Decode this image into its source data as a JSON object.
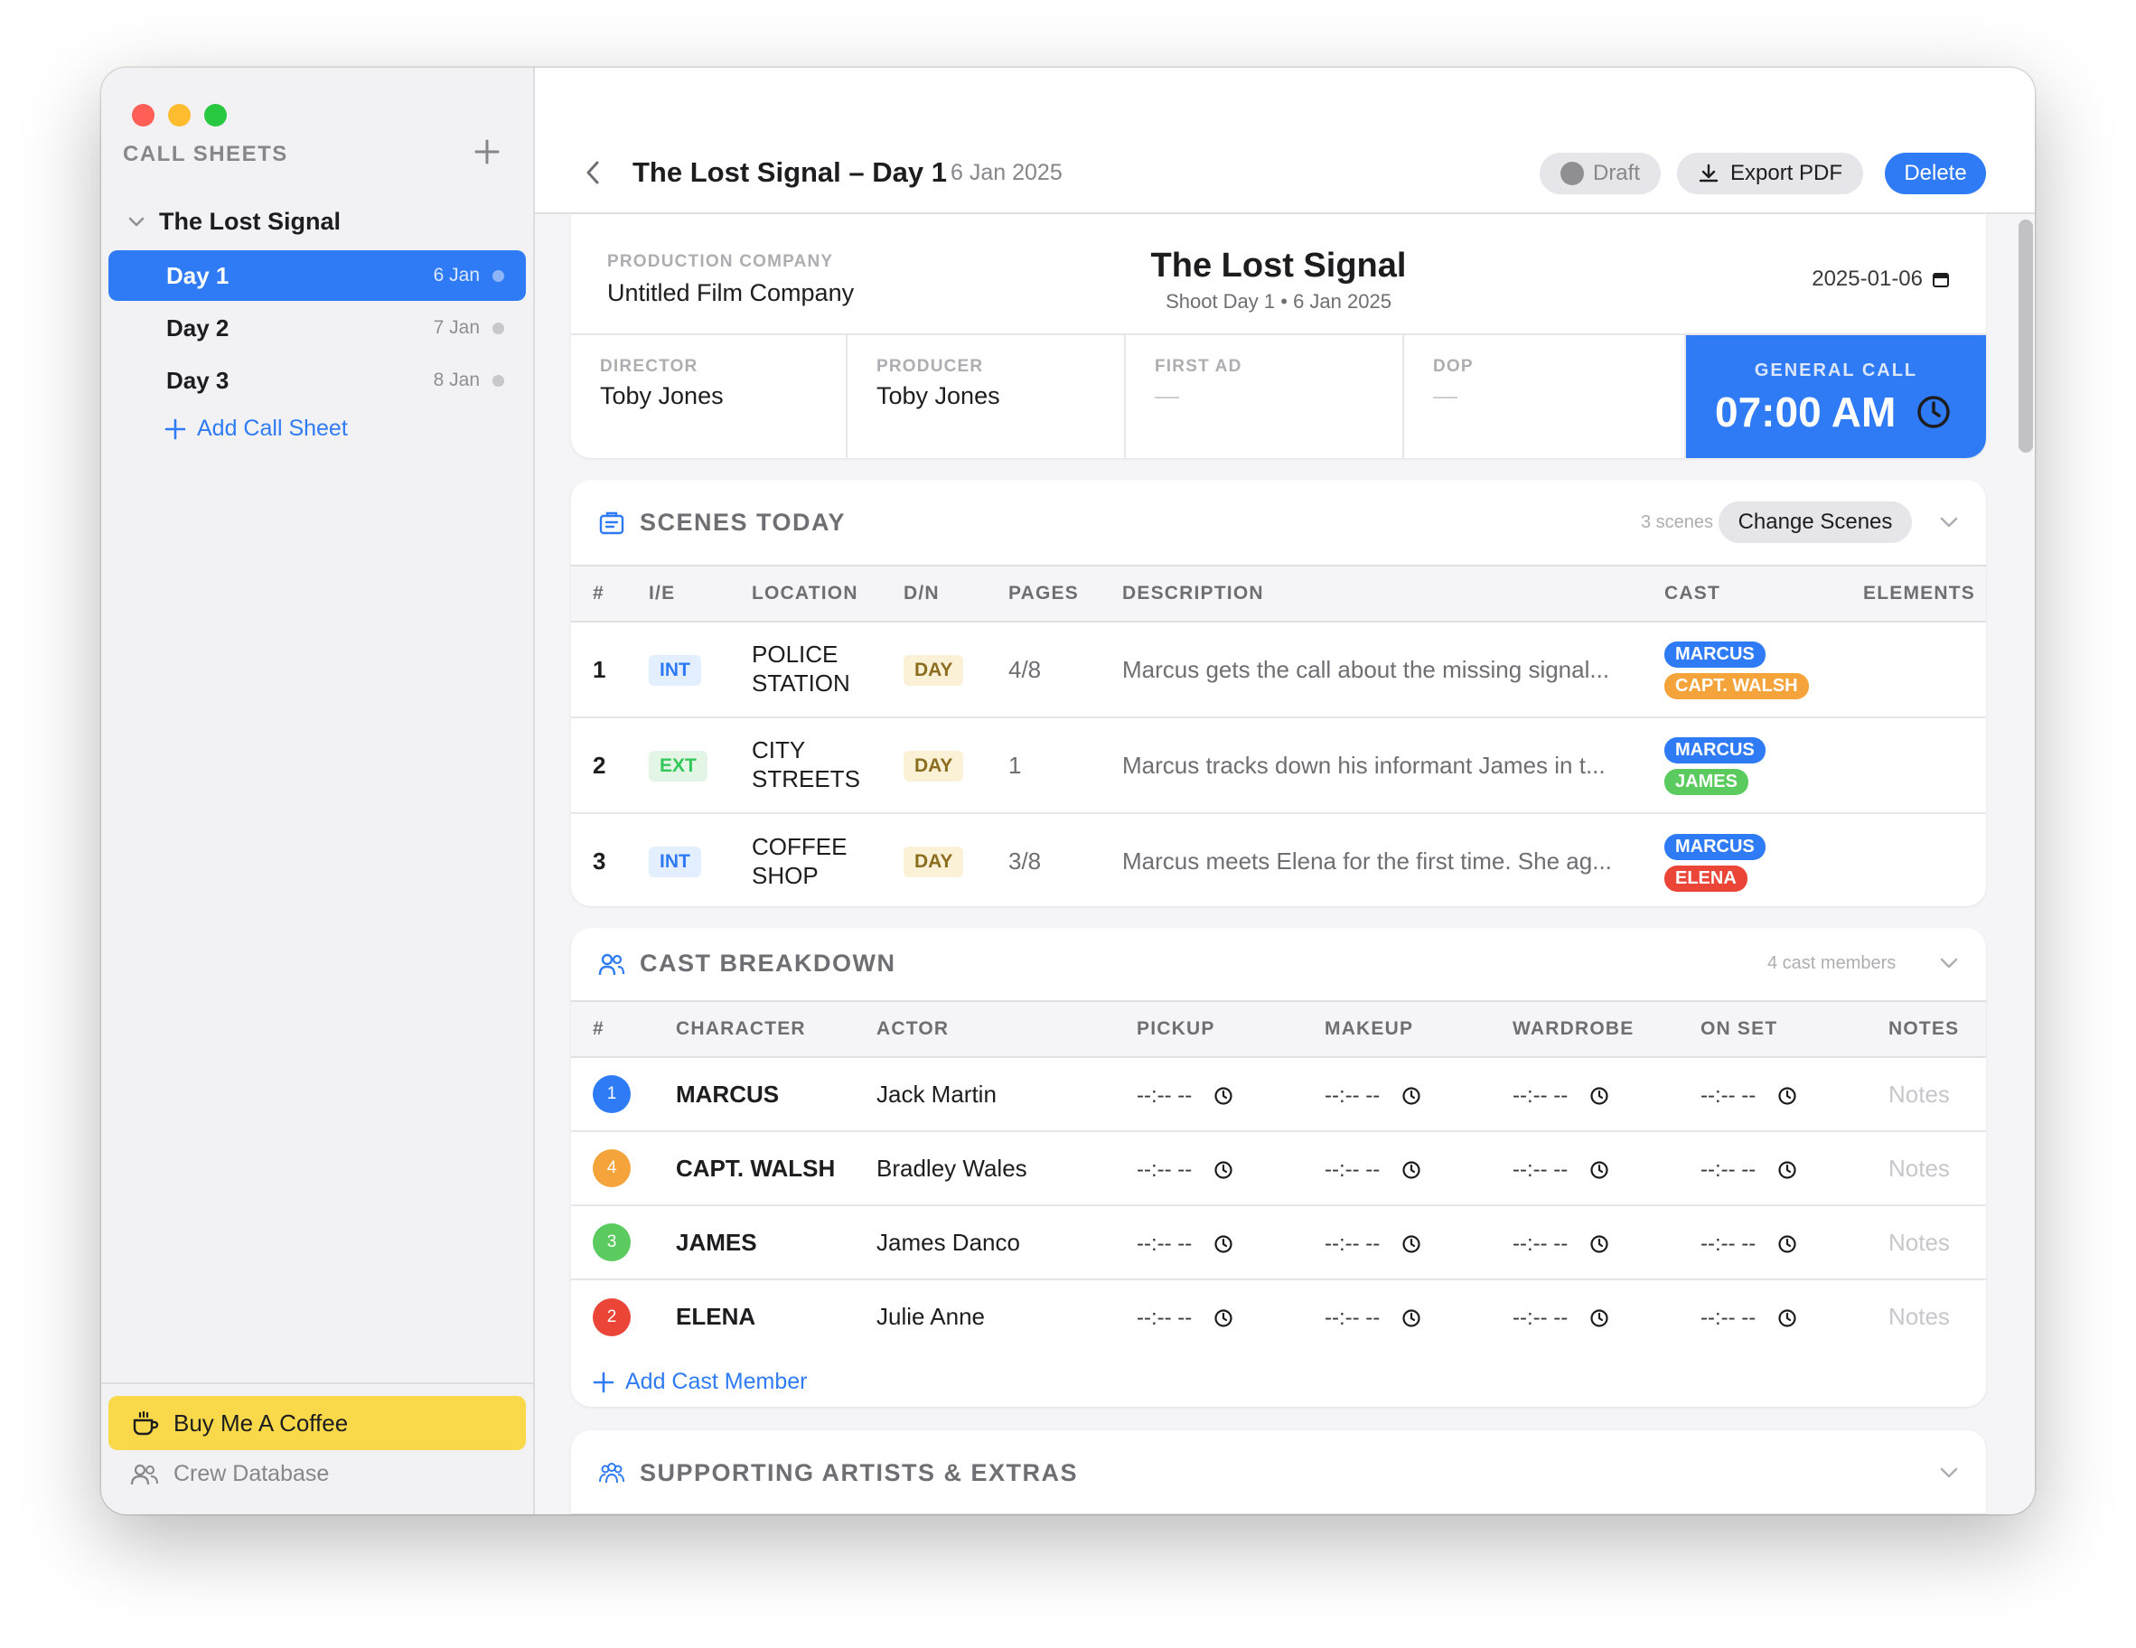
{
  "sidebar": {
    "title": "CALL SHEETS",
    "project": "The Lost Signal",
    "days": [
      {
        "label": "Day 1",
        "date": "6 Jan"
      },
      {
        "label": "Day 2",
        "date": "7 Jan"
      },
      {
        "label": "Day 3",
        "date": "8 Jan"
      }
    ],
    "add_label": "Add Call Sheet",
    "coffee_label": "Buy Me A Coffee",
    "crew_label": "Crew Database"
  },
  "toolbar": {
    "title": "The Lost Signal – Day 1",
    "date": "6 Jan 2025",
    "draft_label": "Draft",
    "export_label": "Export PDF",
    "delete_label": "Delete"
  },
  "header": {
    "production_company_label": "PRODUCTION COMPANY",
    "production_company": "Untitled Film Company",
    "film_title": "The Lost Signal",
    "subtitle": "Shoot Day 1 • 6 Jan 2025",
    "date_value": "2025-01-06",
    "crew": [
      {
        "label": "DIRECTOR",
        "value": "Toby Jones"
      },
      {
        "label": "PRODUCER",
        "value": "Toby Jones"
      },
      {
        "label": "FIRST AD",
        "value": "—"
      },
      {
        "label": "DOP",
        "value": "—"
      }
    ],
    "general_call_label": "GENERAL CALL",
    "general_call_time": "07:00 AM"
  },
  "scenes": {
    "title": "SCENES TODAY",
    "count": "3 scenes",
    "change_label": "Change Scenes",
    "columns": [
      "#",
      "I/E",
      "LOCATION",
      "D/N",
      "PAGES",
      "DESCRIPTION",
      "CAST",
      "ELEMENTS"
    ],
    "rows": [
      {
        "num": "1",
        "ie": "INT",
        "location_1": "POLICE",
        "location_2": "STATION",
        "dn": "DAY",
        "pages": "4/8",
        "description": "Marcus gets the call about the missing signal...",
        "cast": [
          "MARCUS",
          "CAPT. WALSH"
        ]
      },
      {
        "num": "2",
        "ie": "EXT",
        "location_1": "CITY",
        "location_2": "STREETS",
        "dn": "DAY",
        "pages": "1",
        "description": "Marcus tracks down his informant James in t...",
        "cast": [
          "MARCUS",
          "JAMES"
        ]
      },
      {
        "num": "3",
        "ie": "INT",
        "location_1": "COFFEE",
        "location_2": "SHOP",
        "dn": "DAY",
        "pages": "3/8",
        "description": "Marcus meets Elena for the first time. She ag...",
        "cast": [
          "MARCUS",
          "ELENA"
        ]
      }
    ]
  },
  "cast_breakdown": {
    "title": "CAST BREAKDOWN",
    "count": "4 cast members",
    "columns": [
      "#",
      "CHARACTER",
      "ACTOR",
      "PICKUP",
      "MAKEUP",
      "WARDROBE",
      "ON SET",
      "NOTES"
    ],
    "time_placeholder": "--:-- --",
    "notes_placeholder": "Notes",
    "rows": [
      {
        "num": "1",
        "character": "MARCUS",
        "actor": "Jack Martin",
        "color": "#2f7bf5"
      },
      {
        "num": "4",
        "character": "CAPT. WALSH",
        "actor": "Bradley Wales",
        "color": "#f5a33b"
      },
      {
        "num": "3",
        "character": "JAMES",
        "actor": "James Danco",
        "color": "#5ccb5f"
      },
      {
        "num": "2",
        "character": "ELENA",
        "actor": "Julie Anne",
        "color": "#eb4537"
      }
    ],
    "add_label": "Add Cast Member"
  },
  "extras": {
    "title": "SUPPORTING ARTISTS & EXTRAS"
  },
  "colors": {
    "accent": "#2f7bf5",
    "coffee": "#f9d949"
  }
}
